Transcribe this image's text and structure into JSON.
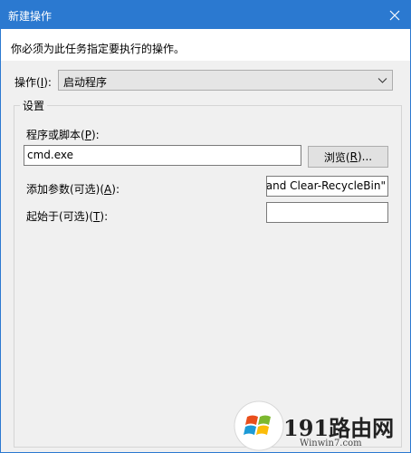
{
  "window": {
    "title": "新建操作"
  },
  "instruction": "你必须为此任务指定要执行的操作。",
  "action": {
    "label_prefix": "操作(",
    "label_key": "I",
    "label_suffix": "):",
    "selected": "启动程序"
  },
  "settings": {
    "legend": "设置",
    "program": {
      "label_prefix": "程序或脚本(",
      "label_key": "P",
      "label_suffix": "):",
      "value": "cmd.exe"
    },
    "browse": {
      "label_prefix": "浏览(",
      "label_key": "R",
      "label_suffix": ")..."
    },
    "arguments": {
      "label_prefix": "添加参数(可选)(",
      "label_key": "A",
      "label_suffix": "):",
      "value": "mand Clear-RecycleBin\""
    },
    "start_in": {
      "label_prefix": "起始于(可选)(",
      "label_key": "T",
      "label_suffix": "):",
      "value": ""
    }
  },
  "watermark": {
    "brand": "191路由网",
    "url": "Winwin7.com"
  },
  "colors": {
    "titlebar": "#2b79d0",
    "dialog_bg": "#f0f0f0"
  }
}
